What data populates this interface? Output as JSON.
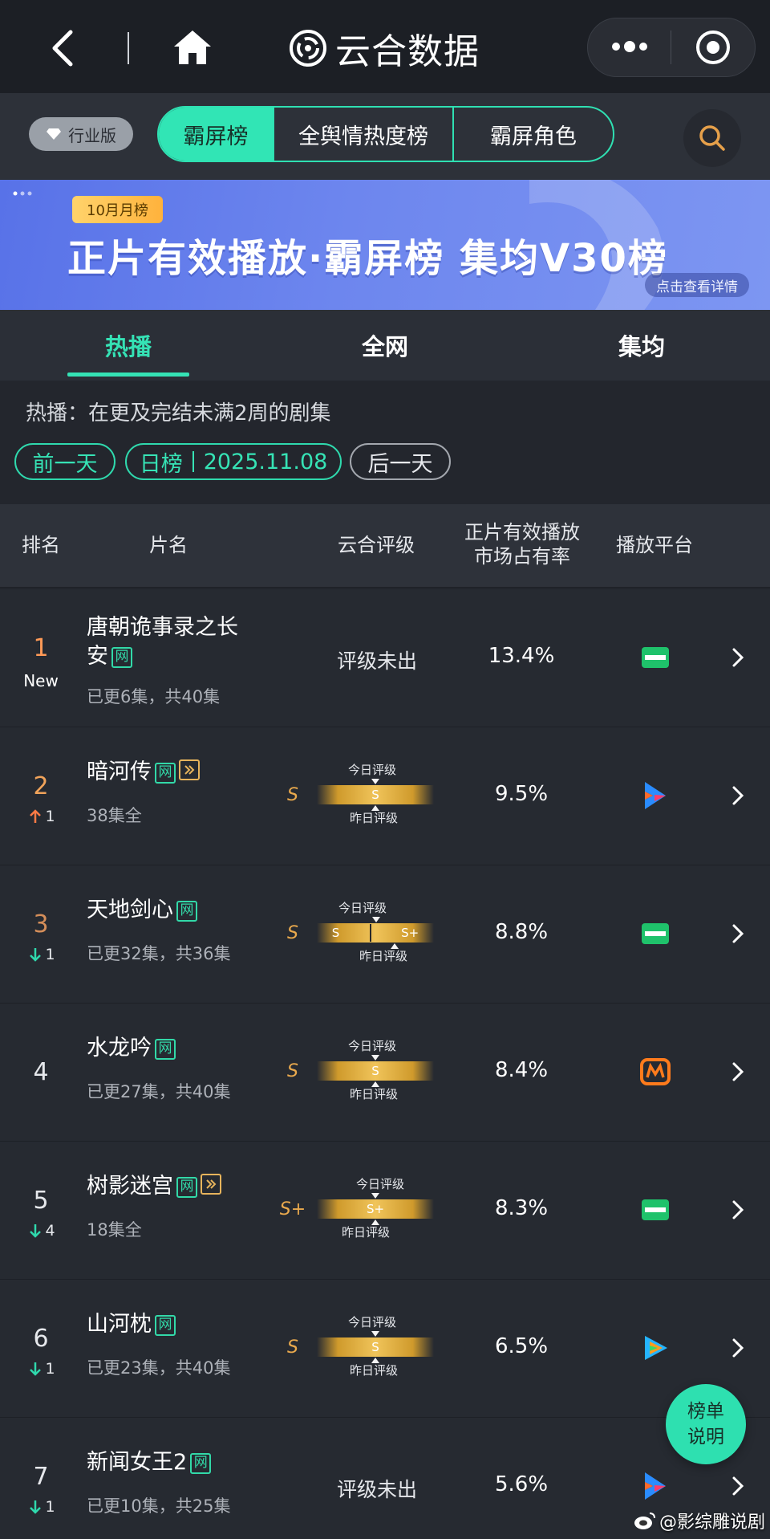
{
  "app": {
    "title": "云合数据"
  },
  "filters": {
    "edition": "行业版",
    "segments": [
      "霸屏榜",
      "全舆情热度榜",
      "霸屏角色"
    ],
    "active_segment": "霸屏榜"
  },
  "banner": {
    "badge": "10月月榜",
    "title": "正片有效播放·霸屏榜 集均V30榜",
    "link": "点击查看详情"
  },
  "tabs": [
    "热播",
    "全网",
    "集均"
  ],
  "active_tab": "热播",
  "info": "热播：在更及完结未满2周的剧集",
  "date_nav": {
    "prev": "前一天",
    "type": "日榜",
    "date": "2025.11.08",
    "next": "后一天"
  },
  "table": {
    "headers": {
      "rank": "排名",
      "title": "片名",
      "grade": "云合评级",
      "share_line1": "正片有效播放",
      "share_line2": "市场占有率",
      "platform": "播放平台"
    },
    "grade_today": "今日评级",
    "grade_yesterday": "昨日评级",
    "grade_none": "评级未出",
    "tag_net": "网",
    "rows": [
      {
        "rank": "1",
        "change": "New",
        "direction": "new",
        "title": "唐朝诡事录之长安",
        "sub": "已更6集，共40集",
        "grade": "",
        "today": "",
        "yesterday": "",
        "share": "13.4%",
        "platform": "iqiyi-icon"
      },
      {
        "rank": "2",
        "change": "1",
        "direction": "up",
        "title": "暗河传",
        "sub": "38集全",
        "grade": "S",
        "today": "S",
        "yesterday": "S",
        "share": "9.5%",
        "platform": "youku-icon"
      },
      {
        "rank": "3",
        "change": "1",
        "direction": "down",
        "title": "天地剑心",
        "sub": "已更32集，共36集",
        "grade": "S",
        "today": "S",
        "yesterday": "S+",
        "share": "8.8%",
        "platform": "iqiyi-icon"
      },
      {
        "rank": "4",
        "change": "",
        "direction": "none",
        "title": "水龙吟",
        "sub": "已更27集，共40集",
        "grade": "S",
        "today": "S",
        "yesterday": "S",
        "share": "8.4%",
        "platform": "mango-icon"
      },
      {
        "rank": "5",
        "change": "4",
        "direction": "down",
        "title": "树影迷宫",
        "sub": "18集全",
        "grade": "S+",
        "today": "S+",
        "yesterday": "S+",
        "share": "8.3%",
        "platform": "iqiyi-icon"
      },
      {
        "rank": "6",
        "change": "1",
        "direction": "down",
        "title": "山河枕",
        "sub": "已更23集，共40集",
        "grade": "S",
        "today": "S",
        "yesterday": "S",
        "share": "6.5%",
        "platform": "tencent-video-icon"
      },
      {
        "rank": "7",
        "change": "1",
        "direction": "down",
        "title": "新闻女王2",
        "sub": "已更10集，共25集",
        "grade": "",
        "today": "",
        "yesterday": "",
        "share": "5.6%",
        "platform": "youku-icon"
      }
    ]
  },
  "float_button": {
    "line1": "榜单",
    "line2": "说明"
  },
  "watermark": "@影综雕说剧",
  "colors": {
    "accent": "#31e5b5",
    "grade_gold": "#e9a94d",
    "up": "#ff7a45",
    "down": "#2fd9ad"
  }
}
